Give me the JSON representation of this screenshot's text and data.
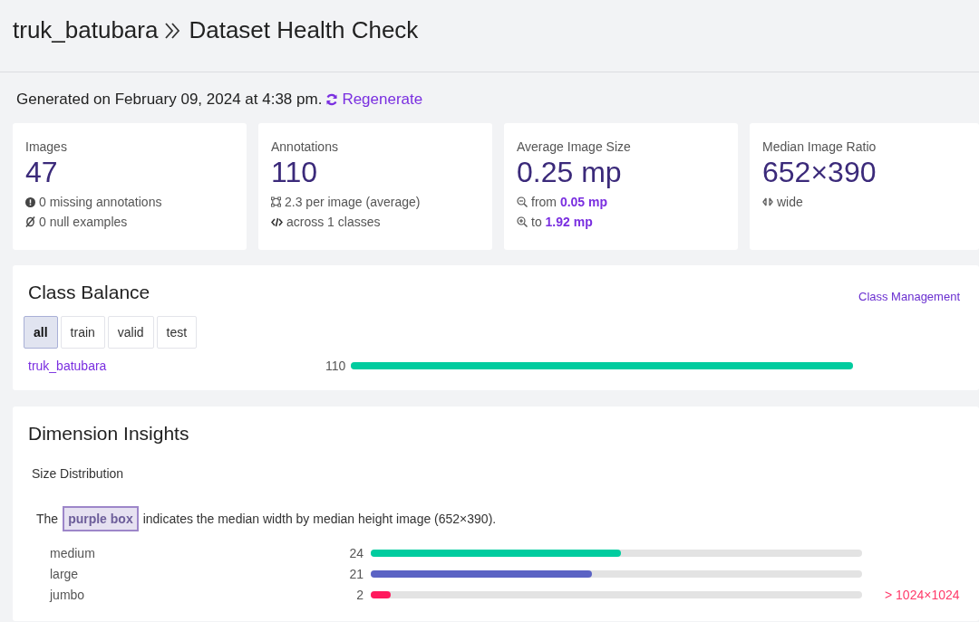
{
  "header": {
    "breadcrumb": "truk_batubara",
    "title": "Dataset Health Check"
  },
  "generated": {
    "text": "Generated on February 09, 2024 at 4:38 pm.",
    "action": "Regenerate"
  },
  "stats": [
    {
      "label": "Images",
      "value": "47",
      "details": [
        {
          "text": "0 missing annotations"
        },
        {
          "text": "0 null examples"
        }
      ]
    },
    {
      "label": "Annotations",
      "value": "110",
      "details": [
        {
          "text": "2.3 per image (average)"
        },
        {
          "text": "across 1 classes"
        }
      ]
    },
    {
      "label": "Average Image Size",
      "value": "0.25 mp",
      "details": [
        {
          "text": "from **0.05 mp**"
        },
        {
          "text": "to **1.92 mp**"
        }
      ]
    },
    {
      "label": "Median Image Ratio",
      "value": "652×390",
      "details": [
        {
          "text": "wide"
        }
      ]
    }
  ],
  "class_balance": {
    "title": "Class Balance",
    "link": "Class Management",
    "tabs": [
      {
        "label": "all",
        "selected": true
      },
      {
        "label": "train",
        "selected": false
      },
      {
        "label": "valid",
        "selected": false
      },
      {
        "label": "test",
        "selected": false
      }
    ],
    "rows": [
      {
        "name": "truk_batubara",
        "count": "110",
        "level": 1,
        "color": "#00cc9f"
      }
    ]
  },
  "dimension": {
    "title": "Dimension Insights",
    "subtitle": "Size Distribution",
    "note_before": "The",
    "highlight": "purple box",
    "note_after": "indicates the median width by median height image (652×390).",
    "rows": [
      {
        "name": "medium",
        "count": "24",
        "level": 0.51,
        "color": "#00cc9f"
      },
      {
        "name": "large",
        "count": "21",
        "level": 0.45,
        "color": "#5b63c4"
      },
      {
        "name": "jumbo",
        "count": "2",
        "level": 0.04,
        "color": "#ff1a5e",
        "note": "> 1024×1024"
      }
    ]
  }
}
